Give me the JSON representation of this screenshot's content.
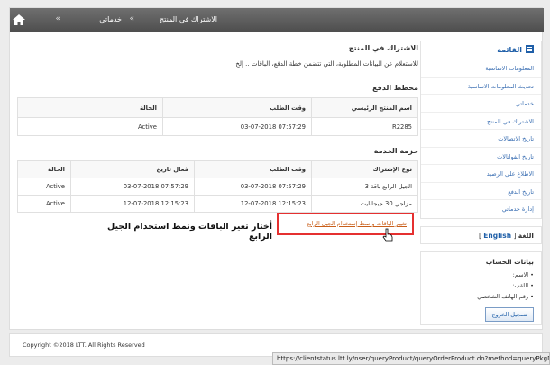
{
  "breadcrumb": {
    "level1": "خدماتي",
    "level2": "الاشتراك في المنتج",
    "separator": "»"
  },
  "sidebar": {
    "menu_title": "القائمة",
    "items": [
      {
        "label": "المعلومات الاساسية"
      },
      {
        "label": "تحديث المعلومات الاساسية"
      },
      {
        "label": "خدماتي"
      },
      {
        "label": "الاشتراك في المنتج"
      },
      {
        "label": "تاريخ الاتصالات"
      },
      {
        "label": "تاريخ الفواتالات"
      },
      {
        "label": "الاطلاع على الرصيد"
      },
      {
        "label": "تاريخ الدفع"
      },
      {
        "label": "إدارة خدماتي"
      }
    ],
    "language_label": "اللغة",
    "language_link": "English",
    "language_brackets_open": "[",
    "language_brackets_close": "]",
    "account_heading": "بيانات الحساب",
    "account_fields": [
      {
        "label": "الاسم:"
      },
      {
        "label": "اللقب:"
      },
      {
        "label": "رقم الهاتف الشخصي"
      }
    ],
    "logout_label": "تسجيل الخروج"
  },
  "main": {
    "title": "الاشتراك في المنتج",
    "intro": "للاستعلام عن البيانات المطلوبة، التي تتضمن خطة الدفع، الباقات .. إلخ",
    "payment_section": "مخطط الدفع",
    "payment_table": {
      "headers": [
        "اسم المنتج الرئيسي",
        "وقت الطلب",
        "الحالة"
      ],
      "rows": [
        [
          "R2285",
          "07:57:29 03-07-2018",
          "Active"
        ]
      ]
    },
    "service_section": "حزمة الخدمة",
    "service_table": {
      "headers": [
        "نوع الإشتراك",
        "وقت الطلب",
        "فعال تاريخ",
        "الحالة"
      ],
      "rows": [
        [
          "الجيل الرابع باقة 3",
          "07:57:29 03-07-2018",
          "07:57:29 03-07-2018",
          "Active"
        ],
        [
          "مزاجي 30 جيجابايت",
          "12:15:23 12-07-2018",
          "12:15:23 12-07-2018",
          "Active"
        ]
      ]
    },
    "change_link": "تغيير الباقات و نمط إستخدام الجيل الرابع",
    "annotation": "أختار تغير الباقات ونمط استخدام الجيل الرابع"
  },
  "footer": {
    "copyright": "Copyright ©2018 LTT. All Rights Reserved"
  },
  "status_bar": {
    "url": "https://clientstatus.ltt.ly/nser/queryProduct/queryOrderProduct.do?method=queryPkgDesc&"
  },
  "colors": {
    "topbar": "#5c5c5c",
    "link": "#3b6fb3",
    "highlight_border": "#e53030",
    "change_link": "#c95f1a"
  }
}
